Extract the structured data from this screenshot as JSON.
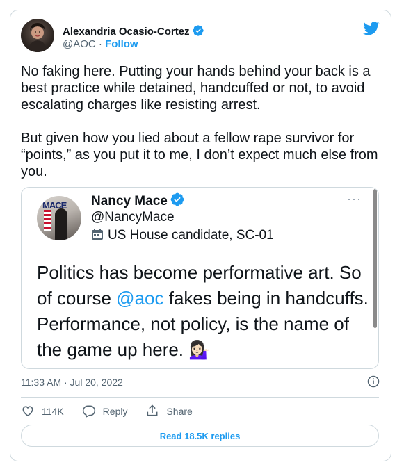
{
  "author": {
    "name": "Alexandria Ocasio-Cortez",
    "handle": "@AOC",
    "separator": " · ",
    "follow_label": "Follow"
  },
  "tweet": {
    "text": "No faking here. Putting your hands behind your back is a best practice while detained, handcuffed or not, to avoid escalating charges like resisting arrest.\n\nBut given how you lied about a fellow rape survivor for “points,” as you put it to me, I don’t expect much else from you.",
    "timestamp": "11:33 AM · Jul 20, 2022"
  },
  "quoted": {
    "name": "Nancy Mace",
    "handle": "@NancyMace",
    "description": "US House candidate, SC-01",
    "more": "···",
    "avatar_sign_text": "MACE",
    "text_before": "Politics has become performative art. So of course ",
    "mention": "@aoc",
    "text_after": " fakes being in handcuffs. Performance, not policy, is the name of the game up here. ",
    "emoji": "💁🏻‍♀️"
  },
  "actions": {
    "likes": "114K",
    "reply_label": "Reply",
    "share_label": "Share"
  },
  "read_replies_label": "Read 18.5K replies",
  "colors": {
    "accent": "#1d9bf0",
    "text": "#0f1419",
    "secondary": "#536471",
    "border": "#cfd9de"
  },
  "icons": {
    "verified": "verified-badge-icon",
    "twitter": "twitter-bird-icon",
    "like": "heart-icon",
    "reply": "speech-bubble-icon",
    "share": "share-upload-icon",
    "info": "info-icon",
    "description": "calendar-icon"
  }
}
